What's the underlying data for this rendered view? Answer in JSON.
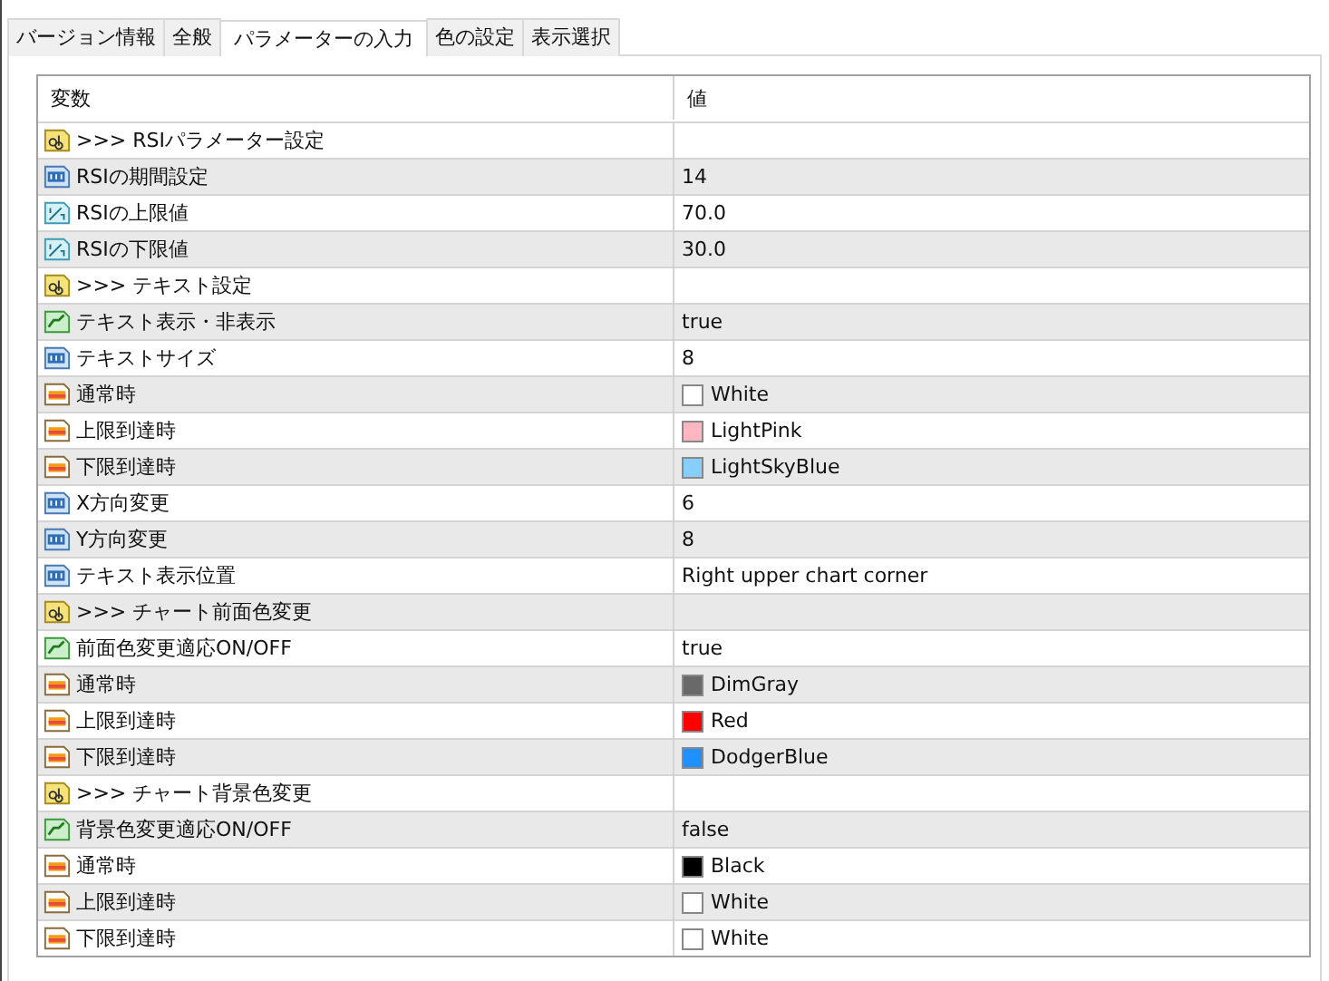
{
  "tabs": [
    {
      "label": "バージョン情報",
      "selected": false
    },
    {
      "label": "全般",
      "selected": false
    },
    {
      "label": "パラメーターの入力",
      "selected": true
    },
    {
      "label": "色の設定",
      "selected": false
    },
    {
      "label": "表示選択",
      "selected": false
    }
  ],
  "table": {
    "columns": [
      "変数",
      "値"
    ],
    "rows": [
      {
        "kind": "string",
        "name": ">>> RSIパラメーター設定"
      },
      {
        "kind": "int",
        "name": "RSIの期間設定",
        "value": "14"
      },
      {
        "kind": "double",
        "name": "RSIの上限値",
        "value": "70.0"
      },
      {
        "kind": "double",
        "name": "RSIの下限値",
        "value": "30.0"
      },
      {
        "kind": "string",
        "name": ">>> テキスト設定"
      },
      {
        "kind": "bool",
        "name": "テキスト表示・非表示",
        "value": "true"
      },
      {
        "kind": "int",
        "name": "テキストサイズ",
        "value": "8"
      },
      {
        "kind": "color",
        "name": "通常時",
        "value": "White",
        "color": "#ffffff"
      },
      {
        "kind": "color",
        "name": "上限到達時",
        "value": "LightPink",
        "color": "#ffb6c1"
      },
      {
        "kind": "color",
        "name": "下限到達時",
        "value": "LightSkyBlue",
        "color": "#87cefa"
      },
      {
        "kind": "int",
        "name": "X方向変更",
        "value": "6"
      },
      {
        "kind": "int",
        "name": "Y方向変更",
        "value": "8"
      },
      {
        "kind": "int",
        "name": "テキスト表示位置",
        "value": "Right upper chart corner"
      },
      {
        "kind": "string",
        "name": ">>> チャート前面色変更"
      },
      {
        "kind": "bool",
        "name": "前面色変更適応ON/OFF",
        "value": "true"
      },
      {
        "kind": "color",
        "name": "通常時",
        "value": "DimGray",
        "color": "#696969"
      },
      {
        "kind": "color",
        "name": "上限到達時",
        "value": "Red",
        "color": "#ff0000"
      },
      {
        "kind": "color",
        "name": "下限到達時",
        "value": "DodgerBlue",
        "color": "#1e90ff"
      },
      {
        "kind": "string",
        "name": ">>> チャート背景色変更"
      },
      {
        "kind": "bool",
        "name": "背景色変更適応ON/OFF",
        "value": "false"
      },
      {
        "kind": "color",
        "name": "通常時",
        "value": "Black",
        "color": "#000000"
      },
      {
        "kind": "color",
        "name": "上限到達時",
        "value": "White",
        "color": "#ffffff"
      },
      {
        "kind": "color",
        "name": "下限到達時",
        "value": "White",
        "color": "#ffffff"
      }
    ]
  }
}
